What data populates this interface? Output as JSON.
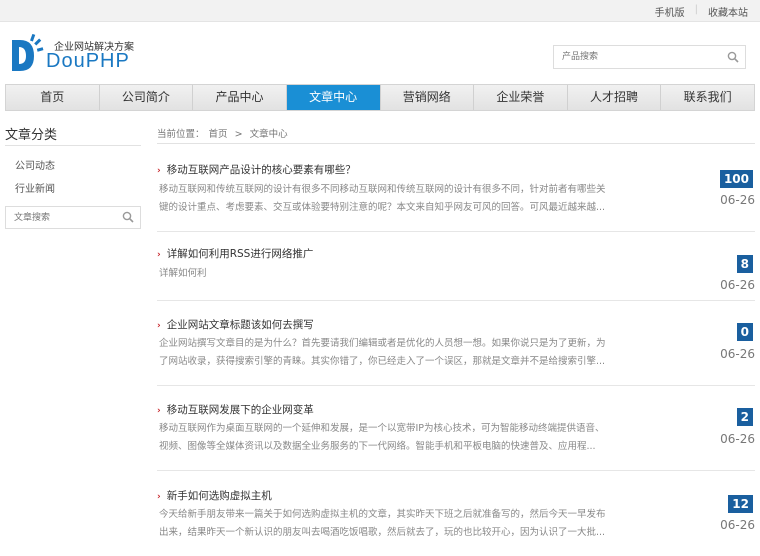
{
  "topbar": {
    "mobile": "手机版",
    "favorite": "收藏本站"
  },
  "header": {
    "slogan": "企业网站解决方案",
    "brand": "DouPHP",
    "search_placeholder": "产品搜索"
  },
  "nav": [
    "首页",
    "公司简介",
    "产品中心",
    "文章中心",
    "营销网络",
    "企业荣誉",
    "人才招聘",
    "联系我们"
  ],
  "nav_active": "文章中心",
  "sidebar": {
    "title": "文章分类",
    "items": [
      "公司动态",
      "行业新闻"
    ],
    "search_placeholder": "文章搜索"
  },
  "breadcrumb": {
    "prefix": "当前位置：",
    "home": "首页",
    "sep": ">",
    "current": "文章中心"
  },
  "articles": [
    {
      "title": "移动互联网产品设计的核心要素有哪些？",
      "desc": "移动互联网和传统互联网的设计有很多不同移动互联网和传统互联网的设计有很多不同，针对前者有哪些关键的设计重点、考虑要素、交互或体验要特别注意的呢？本文来自知乎网友可风的回答。可风最近越来越...",
      "views": "100",
      "date": "06-26"
    },
    {
      "title": "详解如何利用RSS进行网络推广",
      "desc": "详解如何利",
      "views": "8",
      "date": "06-26"
    },
    {
      "title": "企业网站文章标题该如何去撰写",
      "desc": "企业网站撰写文章目的是为什么？首先要请我们编辑或者是优化的人员想一想。如果你说只是为了更新，为了网站收录，获得搜索引擎的青睐。其实你错了，你已经走入了一个误区，那就是文章并不是给搜索引擎...",
      "views": "0",
      "date": "06-26"
    },
    {
      "title": "移动互联网发展下的企业网变革",
      "desc": "移动互联网作为桌面互联网的一个延伸和发展，是一个以宽带IP为核心技术，可为智能移动终端提供语音、视频、图像等全媒体资讯以及数据全业务服务的下一代网络。智能手机和平板电脑的快速普及、应用程...",
      "views": "2",
      "date": "06-26"
    },
    {
      "title": "新手如何选购虚拟主机",
      "desc": "今天给新手朋友带来一篇关于如何选购虚拟主机的文章，其实昨天下班之后就准备写的，然后今天一早发布出来，结果昨天一个新认识的朋友叫去喝酒吃饭唱歌，然后就去了，玩的也比较开心，因为认识了一大批...",
      "views": "12",
      "date": "06-26"
    }
  ]
}
